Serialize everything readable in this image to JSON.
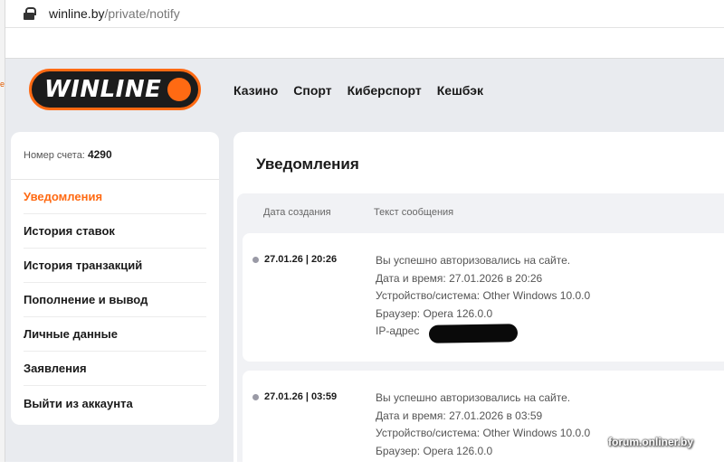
{
  "browser": {
    "url_host": "winline.by",
    "url_path": "/private/notify"
  },
  "header": {
    "logo_text": "WINLINE",
    "nav": [
      "Казино",
      "Спорт",
      "Киберспорт",
      "Кешбэк"
    ]
  },
  "sidebar": {
    "account_label": "Номер счета:",
    "account_number": "4290",
    "items": [
      {
        "label": "Уведомления",
        "active": true
      },
      {
        "label": "История ставок",
        "active": false
      },
      {
        "label": "История транзакций",
        "active": false
      },
      {
        "label": "Пополнение и вывод",
        "active": false
      },
      {
        "label": "Личные данные",
        "active": false
      },
      {
        "label": "Заявления",
        "active": false
      },
      {
        "label": "Выйти из аккаунта",
        "active": false
      }
    ]
  },
  "main": {
    "title": "Уведомления",
    "columns": [
      "Дата создания",
      "Текст сообщения"
    ],
    "notifications": [
      {
        "date": "27.01.26 | 20:26",
        "lines": [
          "Вы успешно авторизовались на сайте.",
          "Дата и время: 27.01.2026 в 20:26",
          "Устройство/система: Other Windows 10.0.0",
          "Браузер: Opera 126.0.0",
          "IP-адрес"
        ]
      },
      {
        "date": "27.01.26 | 03:59",
        "lines": [
          "Вы успешно авторизовались на сайте.",
          "Дата и время: 27.01.2026 в 03:59",
          "Устройство/система: Other Windows 10.0.0",
          "Браузер: Opera 126.0.0"
        ]
      }
    ]
  },
  "watermark": "forum.onliner.by",
  "colors": {
    "accent": "#ff6a13",
    "background": "#e9ebef"
  }
}
